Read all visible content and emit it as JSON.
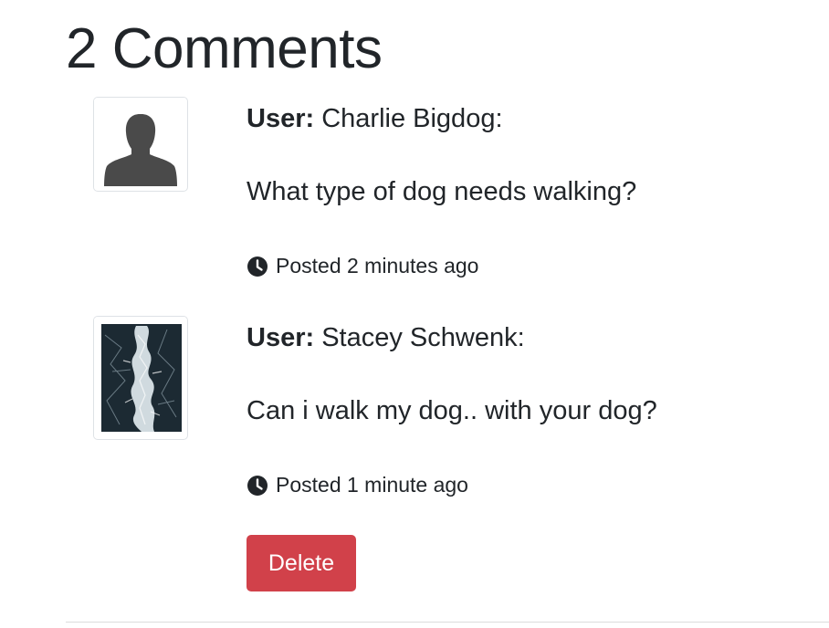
{
  "comments_section": {
    "heading": "2 Comments",
    "comments": [
      {
        "user_label": "User:",
        "user_name": "Charlie Bigdog:",
        "text": "What type of dog needs walking?",
        "posted": "Posted 2 minutes ago",
        "avatar_icon": "default-user-silhouette-icon"
      },
      {
        "user_label": "User:",
        "user_name": "Stacey Schwenk:",
        "text": "Can i walk my dog.. with your dog?",
        "posted": "Posted 1 minute ago",
        "avatar_icon": "user-photo"
      }
    ],
    "delete_label": "Delete"
  },
  "colors": {
    "text": "#212529",
    "delete_button": "#d1414a",
    "thumb_border": "#dee2e6",
    "avatar_silhouette": "#4a4a4a"
  }
}
